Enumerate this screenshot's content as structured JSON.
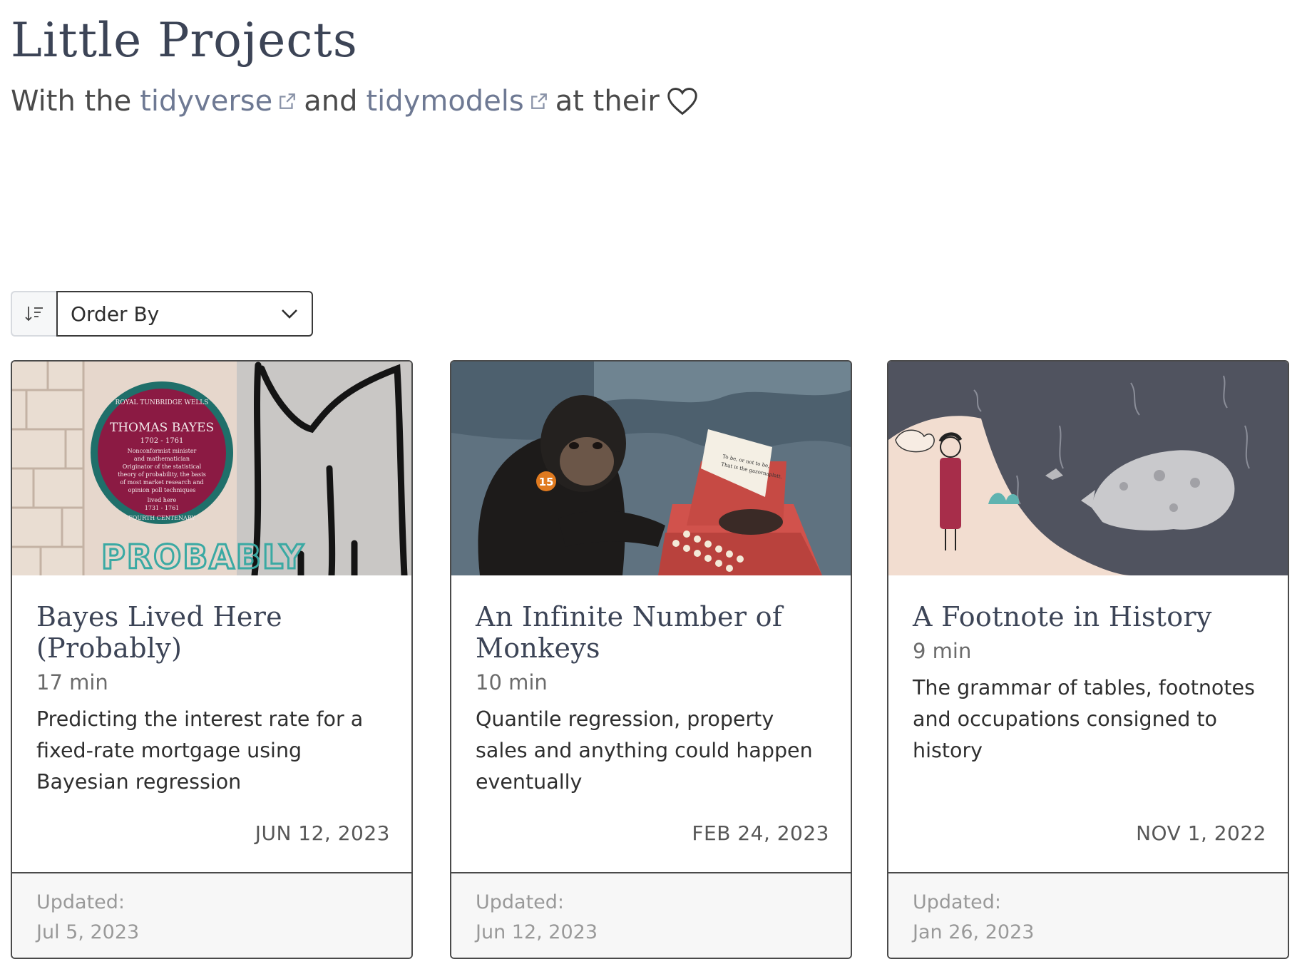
{
  "header": {
    "title": "Little Projects",
    "subtitle_prefix": "With the",
    "link1": "tidyverse",
    "subtitle_mid": "and",
    "link2": "tidymodels",
    "subtitle_suffix": "at their",
    "link_color": "#6e7993"
  },
  "sort": {
    "label": "Order By",
    "icon": "sort-icon"
  },
  "cards": [
    {
      "title": "Bayes Lived Here (Probably)",
      "time": "17 min",
      "description": "Predicting the interest rate for a fixed-rate mortgage using Bayesian regression",
      "date": "JUN 12, 2023",
      "updated_label": "Updated:",
      "updated_date": "Jul 5, 2023",
      "plaque": {
        "arc_top": "ROYAL TUNBRIDGE WELLS",
        "name": "THOMAS BAYES",
        "years": "1702 - 1761",
        "line1": "Nonconformist minister",
        "line2": "and mathematician",
        "line3": "Originator of the statistical",
        "line4": "theory of probability, the basis",
        "line5": "of most market research and",
        "line6": "opinion poll techniques",
        "line7": "lived here",
        "line8": "1731 - 1761",
        "arc_bottom": "FOURTH CENTENARY"
      },
      "graffiti": "PROBABLY"
    },
    {
      "title": "An Infinite Number of Monkeys",
      "time": "10 min",
      "description": "Quantile regression, property sales and anything could happen eventually",
      "date": "FEB 24, 2023",
      "updated_label": "Updated:",
      "updated_date": "Jun 12, 2023",
      "tag": "15",
      "paper_line1": "To be, or not to be,",
      "paper_line2": "That is the gazornaplatt."
    },
    {
      "title": "A Footnote in History",
      "time": "9 min",
      "description": "The grammar of tables, footnotes and occupations consigned to history",
      "date": "NOV 1, 2022",
      "updated_label": "Updated:",
      "updated_date": "Jan 26, 2023"
    }
  ]
}
